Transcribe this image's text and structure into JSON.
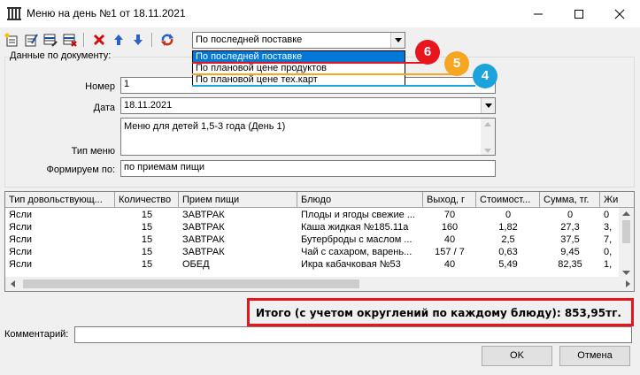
{
  "window": {
    "title": "Меню на день №1 от 18.11.2021"
  },
  "toolbar": {
    "icons": [
      "new-doc-icon",
      "edit-doc-icon",
      "table-edit-icon",
      "table-delete-icon",
      "delete-x-icon",
      "arrow-up-icon",
      "arrow-down-icon",
      "refresh-icon"
    ],
    "price_mode": {
      "value": "По последней поставке",
      "options": [
        "По последней поставке",
        "По плановой цене продуктов",
        "По плановой цене тех.карт"
      ]
    }
  },
  "badges": [
    {
      "label": "6",
      "color": "#e8151c"
    },
    {
      "label": "5",
      "color": "#f5a623"
    },
    {
      "label": "4",
      "color": "#1ca3dc"
    }
  ],
  "doc": {
    "group_label": "Данные по документу:",
    "number_label": "Номер",
    "number_value": "1",
    "date_label": "Дата",
    "date_value": "18.11.2021",
    "type_label": "Тип меню",
    "type_value": "Меню для детей 1,5-3 года (День 1)",
    "form_label": "Формируем по:",
    "form_value": "по приемам пищи"
  },
  "grid": {
    "columns": [
      "Тип довольствующ...",
      "Количество",
      "Прием пищи",
      "Блюдо",
      "Выход, г",
      "Стоимост...",
      "Сумма, тг.",
      "Жи"
    ],
    "rows": [
      [
        "Ясли",
        "15",
        "ЗАВТРАК",
        "Плоды и ягоды свежие ...",
        "70",
        "0",
        "0",
        "0"
      ],
      [
        "Ясли",
        "15",
        "ЗАВТРАК",
        "Каша жидкая №185.11а",
        "160",
        "1,82",
        "27,3",
        "3,"
      ],
      [
        "Ясли",
        "15",
        "ЗАВТРАК",
        "Бутерброды с маслом ...",
        "40",
        "2,5",
        "37,5",
        "7,"
      ],
      [
        "Ясли",
        "15",
        "ЗАВТРАК",
        "Чай с сахаром, варень...",
        "157 / 7",
        "0,63",
        "9,45",
        "0,"
      ],
      [
        "Ясли",
        "15",
        "ОБЕД",
        "Икра кабачковая №53",
        "40",
        "5,49",
        "82,35",
        "1,"
      ]
    ]
  },
  "total": "Итого (с учетом округлений по каждому блюду): 853,95тг.",
  "comment": {
    "label": "Комментарий:",
    "value": ""
  },
  "buttons": {
    "ok": "OK",
    "cancel": "Отмена"
  },
  "colors": {
    "highlight_red": "#e8151c",
    "highlight_orange": "#f5a623",
    "highlight_blue": "#1ca3dc",
    "selection": "#0078d7"
  }
}
